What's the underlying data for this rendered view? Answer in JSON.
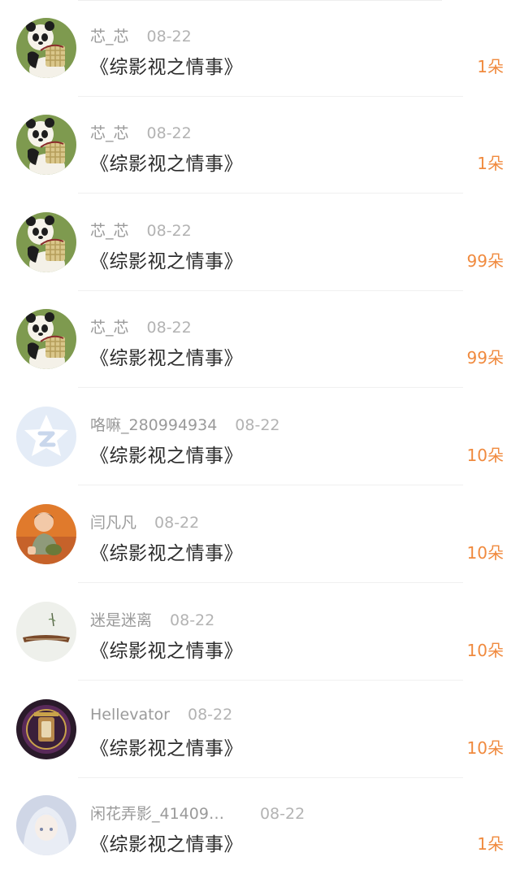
{
  "gifts": [
    {
      "user": "芯_芯",
      "date": "08-22",
      "book": "《综影视之情事》",
      "amount": "1朵",
      "avatar": "panda-avatar"
    },
    {
      "user": "芯_芯",
      "date": "08-22",
      "book": "《综影视之情事》",
      "amount": "1朵",
      "avatar": "panda-avatar"
    },
    {
      "user": "芯_芯",
      "date": "08-22",
      "book": "《综影视之情事》",
      "amount": "99朵",
      "avatar": "panda-avatar"
    },
    {
      "user": "芯_芯",
      "date": "08-22",
      "book": "《综影视之情事》",
      "amount": "99朵",
      "avatar": "panda-avatar"
    },
    {
      "user": "咯嘛_280994934",
      "date": "08-22",
      "book": "《综影视之情事》",
      "amount": "10朵",
      "avatar": "qq-star-avatar"
    },
    {
      "user": "闫凡凡",
      "date": "08-22",
      "book": "《综影视之情事》",
      "amount": "10朵",
      "avatar": "child-photo-avatar"
    },
    {
      "user": "迷是迷离",
      "date": "08-22",
      "book": "《综影视之情事》",
      "amount": "10朵",
      "avatar": "guzheng-avatar"
    },
    {
      "user": "Hellevator",
      "date": "08-22",
      "book": "《综影视之情事》",
      "amount": "10朵",
      "avatar": "ornate-emblem-avatar"
    },
    {
      "user": "闲花弄影_41409…",
      "date": "08-22",
      "book": "《综影视之情事》",
      "amount": "1朵",
      "avatar": "anime-girl-avatar"
    }
  ],
  "colors": {
    "amount": "#f08a3e",
    "username": "#9a9a9a",
    "title": "#2b2b2b",
    "panda_bg": "#7e9a4f"
  }
}
